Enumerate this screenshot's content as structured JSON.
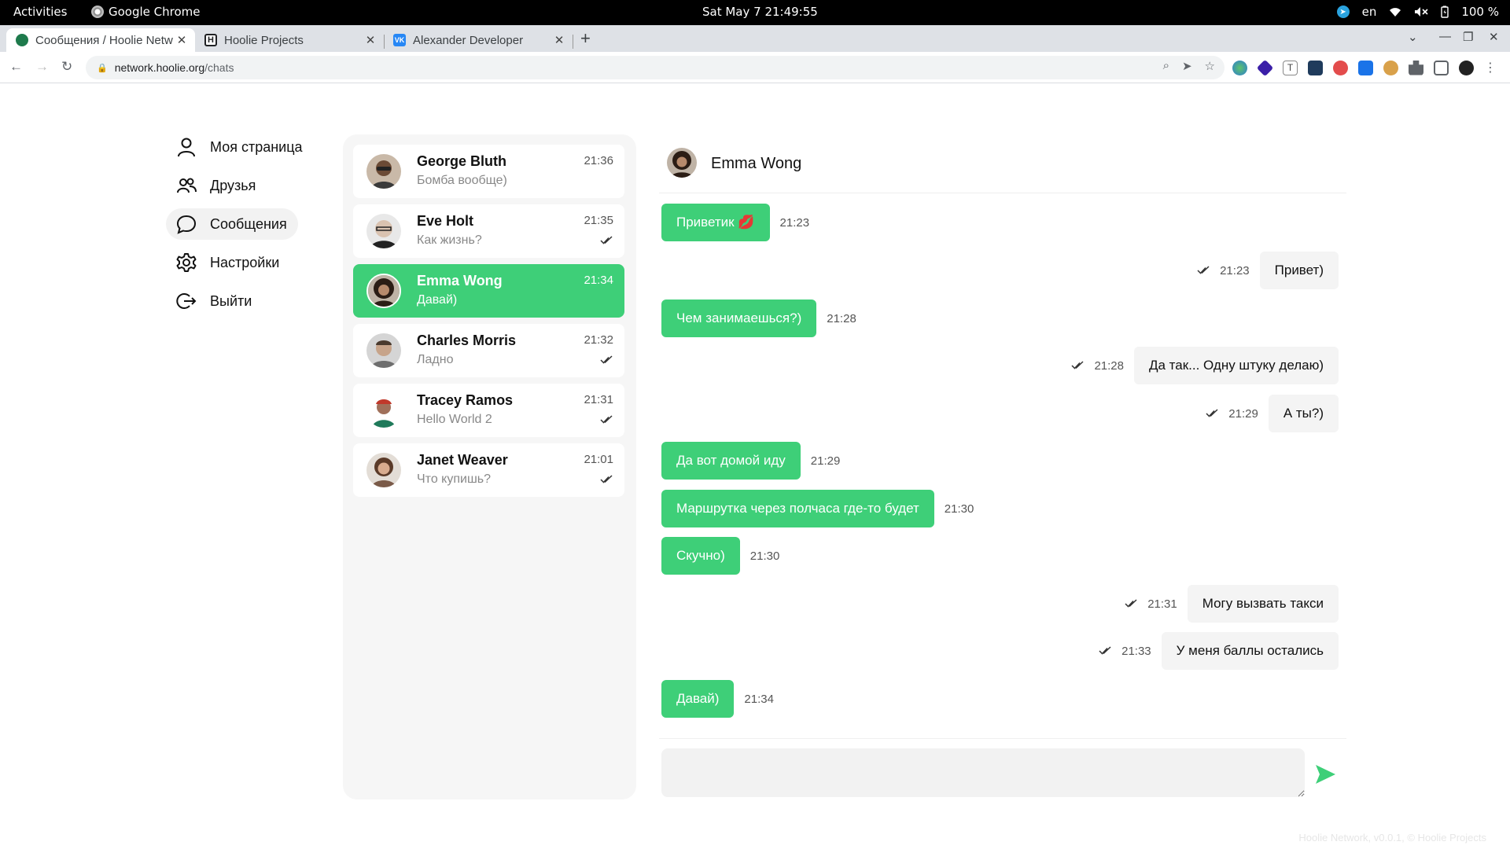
{
  "system_bar": {
    "activities": "Activities",
    "app_name": "Google Chrome",
    "clock": "Sat May 7  21:49:55",
    "lang": "en",
    "battery": "100 %"
  },
  "browser": {
    "tabs": [
      {
        "label": "Сообщения / Hoolie Netw",
        "favicon": "hoolie-network-favicon",
        "color": "#1e7a4c"
      },
      {
        "label": "Hoolie Projects",
        "favicon": "H",
        "color": "#202124"
      },
      {
        "label": "Alexander Developer",
        "favicon": "VK",
        "color": "#2787f5"
      }
    ],
    "url_host": "network.hoolie.org",
    "url_path": "/chats"
  },
  "nav": {
    "items": [
      {
        "label": "Моя страница",
        "icon": "user-icon"
      },
      {
        "label": "Друзья",
        "icon": "friends-icon"
      },
      {
        "label": "Сообщения",
        "icon": "chat-bubble-icon"
      },
      {
        "label": "Настройки",
        "icon": "gear-icon"
      },
      {
        "label": "Выйти",
        "icon": "logout-icon"
      }
    ]
  },
  "chats": [
    {
      "name": "George Bluth",
      "preview": "Бомба вообще)",
      "time": "21:36",
      "read": false
    },
    {
      "name": "Eve Holt",
      "preview": "Как жизнь?",
      "time": "21:35",
      "read": true
    },
    {
      "name": "Emma Wong",
      "preview": "Давай)",
      "time": "21:34",
      "read": false
    },
    {
      "name": "Charles Morris",
      "preview": "Ладно",
      "time": "21:32",
      "read": true
    },
    {
      "name": "Tracey Ramos",
      "preview": "Hello World 2",
      "time": "21:31",
      "read": true
    },
    {
      "name": "Janet Weaver",
      "preview": "Что купишь?",
      "time": "21:01",
      "read": true
    }
  ],
  "conversation": {
    "contact": "Emma Wong",
    "messages": [
      {
        "dir": "in",
        "text": "Приветик 💋",
        "time": "21:23"
      },
      {
        "dir": "out",
        "text": "Привет)",
        "time": "21:23"
      },
      {
        "dir": "in",
        "text": "Чем занимаешься?)",
        "time": "21:28"
      },
      {
        "dir": "out",
        "text": "Да так... Одну штуку делаю)",
        "time": "21:28"
      },
      {
        "dir": "out",
        "text": "А ты?)",
        "time": "21:29"
      },
      {
        "dir": "in",
        "text": "Да вот домой иду",
        "time": "21:29"
      },
      {
        "dir": "in",
        "text": "Маршрутка через полчаса где-то будет",
        "time": "21:30"
      },
      {
        "dir": "in",
        "text": "Скучно)",
        "time": "21:30"
      },
      {
        "dir": "out",
        "text": "Могу вызвать такси",
        "time": "21:31"
      },
      {
        "dir": "out",
        "text": "У меня баллы остались",
        "time": "21:33"
      },
      {
        "dir": "in",
        "text": "Давай)",
        "time": "21:34"
      }
    ],
    "composer_value": ""
  },
  "footer": "Hoolie Network, v0.0.1, © Hoolie Projects",
  "colors": {
    "accent": "#3ecf78",
    "panel": "#f6f6f6"
  }
}
